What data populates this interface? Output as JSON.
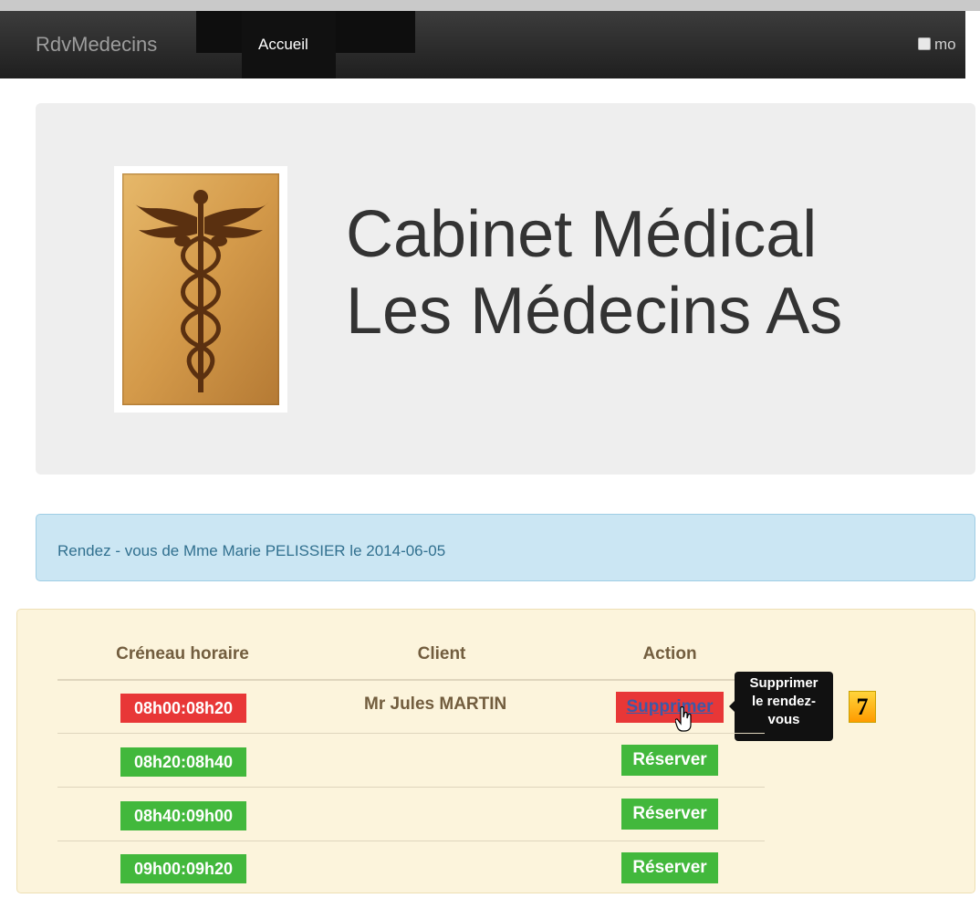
{
  "navbar": {
    "brand": "RdvMedecins",
    "active_item": "Accueil",
    "checkbox_label": "mo"
  },
  "hero": {
    "title_line1": "Cabinet Médical",
    "title_line2": "Les Médecins As"
  },
  "alert": {
    "text": "Rendez - vous de Mme Marie PELISSIER le 2014-06-05"
  },
  "table": {
    "headers": [
      "Créneau horaire",
      "Client",
      "Action"
    ],
    "rows": [
      {
        "slot": "08h00:08h20",
        "client": "Mr Jules MARTIN",
        "action": "Supprimer",
        "status": "busy"
      },
      {
        "slot": "08h20:08h40",
        "client": "",
        "action": "Réserver",
        "status": "free"
      },
      {
        "slot": "08h40:09h00",
        "client": "",
        "action": "Réserver",
        "status": "free"
      },
      {
        "slot": "09h00:09h20",
        "client": "",
        "action": "Réserver",
        "status": "free"
      }
    ]
  },
  "tooltip": {
    "line1": "Supprimer",
    "line2": "le rendez-",
    "line3": "vous"
  },
  "badge": "7",
  "icons": [
    "caduceus-icon",
    "hand-cursor-icon",
    "checkbox-icon"
  ],
  "colors": {
    "busy": "#e83737",
    "free": "#42b83c",
    "panel": "#fcf4dc",
    "alert": "#cbe6f3",
    "navbar": "#222222"
  }
}
